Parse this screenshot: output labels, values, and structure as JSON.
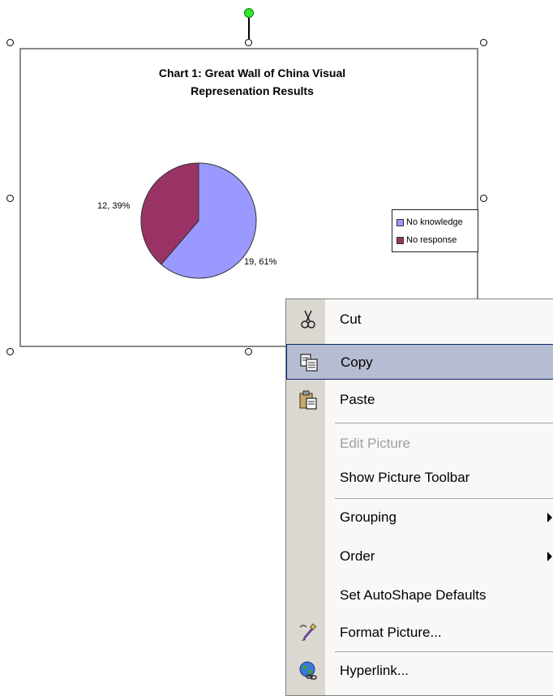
{
  "chart": {
    "title_line1": "Chart 1:  Great Wall of China Visual",
    "title_line2": "Represenation Results",
    "legend": [
      "No knowledge",
      "No response"
    ],
    "data_labels": [
      "12, 39%",
      "19, 61%"
    ]
  },
  "chart_data": {
    "type": "pie",
    "title": "Chart 1:  Great Wall of China Visual Represenation Results",
    "categories": [
      "No knowledge",
      "No response"
    ],
    "values": [
      19,
      12
    ],
    "percentages": [
      61,
      39
    ],
    "data_labels": [
      "19, 61%",
      "12, 39%"
    ],
    "colors": [
      "#9999ff",
      "#993366"
    ],
    "legend_position": "right"
  },
  "context_menu": {
    "items": [
      {
        "label": "Cut",
        "icon": "scissors-icon"
      },
      {
        "label": "Copy",
        "icon": "copy-icon",
        "highlighted": true
      },
      {
        "label": "Paste",
        "icon": "paste-icon"
      },
      {
        "label": "Edit Picture",
        "disabled": true
      },
      {
        "label": "Show Picture Toolbar"
      },
      {
        "label": "Grouping",
        "submenu": true
      },
      {
        "label": "Order",
        "submenu": true
      },
      {
        "label": "Set AutoShape Defaults"
      },
      {
        "label": "Format Picture...",
        "icon": "format-picture-icon"
      },
      {
        "label": "Hyperlink...",
        "icon": "hyperlink-globe-icon"
      }
    ]
  },
  "colors": {
    "selection_highlight": "#b6bdd2",
    "menu_gutter": "#dbd8d1",
    "rotation_handle": "#2ee82e"
  }
}
